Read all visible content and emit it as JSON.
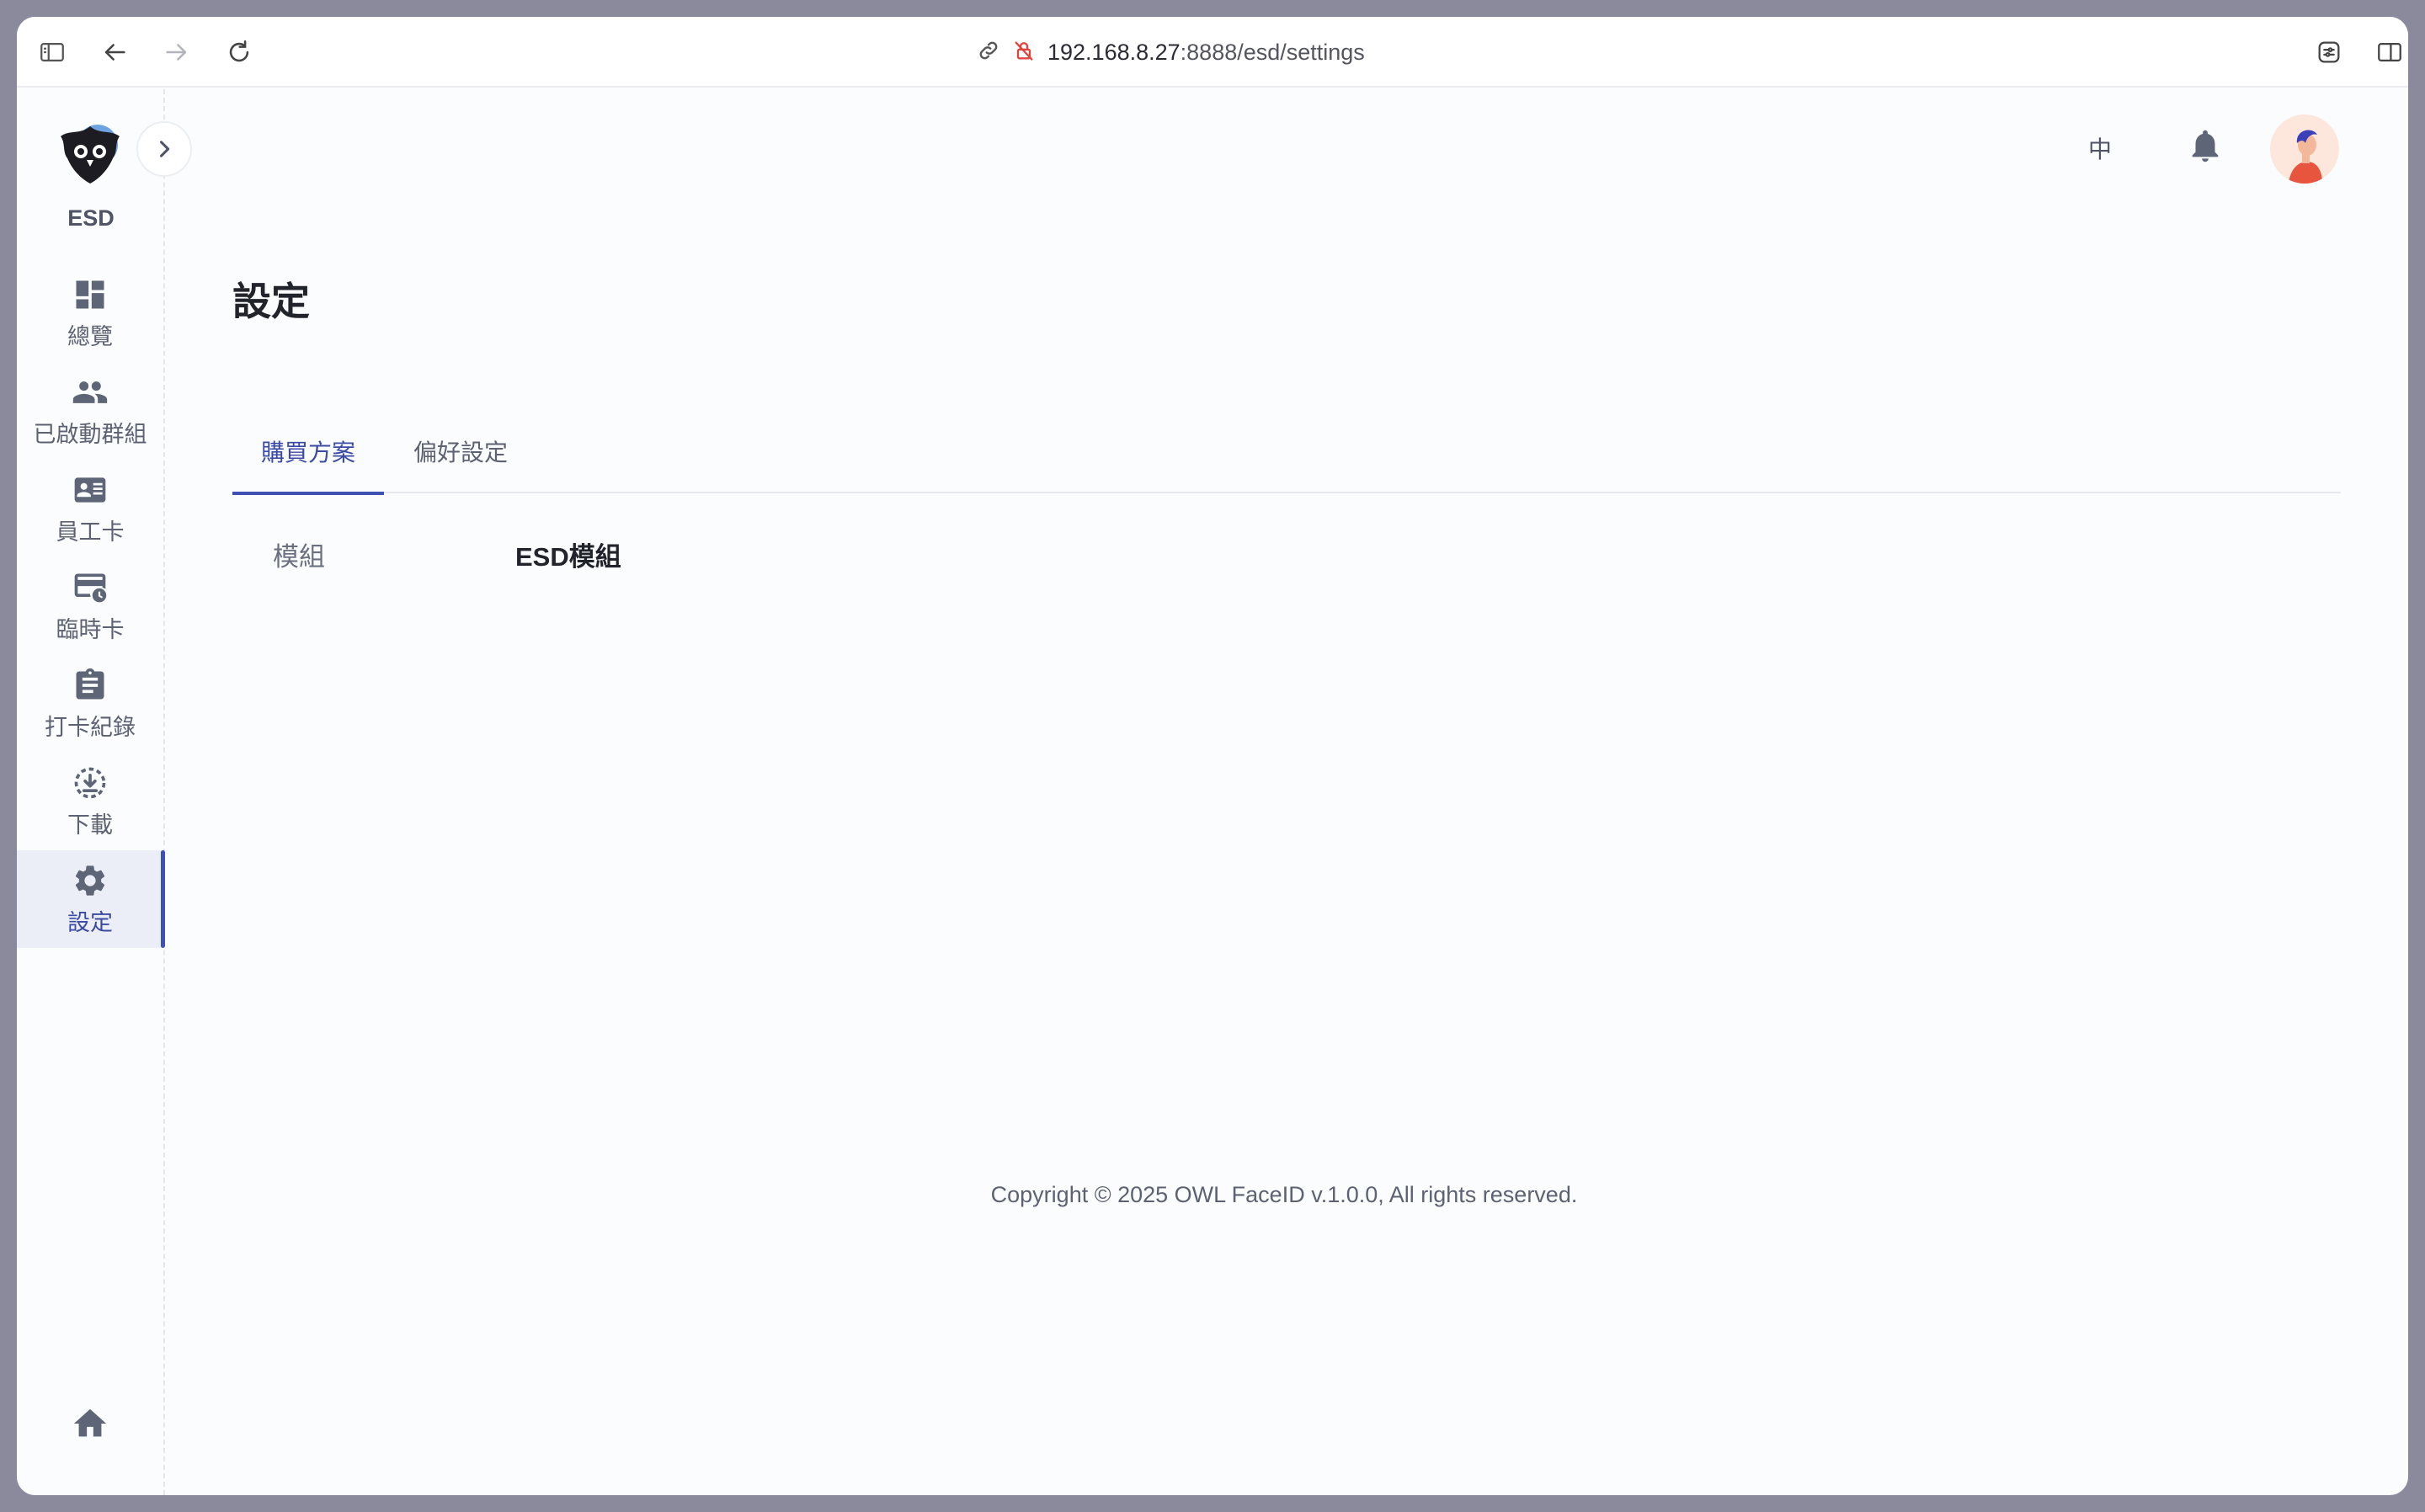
{
  "browser": {
    "url_host": "192.168.8.27",
    "url_rest": ":8888/esd/settings"
  },
  "sidebar": {
    "brand": "ESD",
    "items": [
      {
        "label": "總覽",
        "icon": "dashboard-icon"
      },
      {
        "label": "已啟動群組",
        "icon": "group-icon"
      },
      {
        "label": "員工卡",
        "icon": "id-card-icon"
      },
      {
        "label": "臨時卡",
        "icon": "temp-card-icon"
      },
      {
        "label": "打卡紀錄",
        "icon": "clipboard-icon"
      },
      {
        "label": "下載",
        "icon": "download-icon"
      },
      {
        "label": "設定",
        "icon": "gear-icon",
        "active": true
      }
    ]
  },
  "header": {
    "language": "中"
  },
  "page": {
    "title": "設定",
    "tabs": [
      {
        "label": "購買方案",
        "active": true
      },
      {
        "label": "偏好設定",
        "active": false
      }
    ],
    "row": {
      "label": "模組",
      "value": "ESD模組"
    }
  },
  "footer": {
    "copyright": "Copyright © 2025 OWL FaceID v.1.0.0, All rights reserved."
  },
  "colors": {
    "accent": "#3f51b5",
    "text": "#22242b",
    "muted": "#5c6272"
  }
}
